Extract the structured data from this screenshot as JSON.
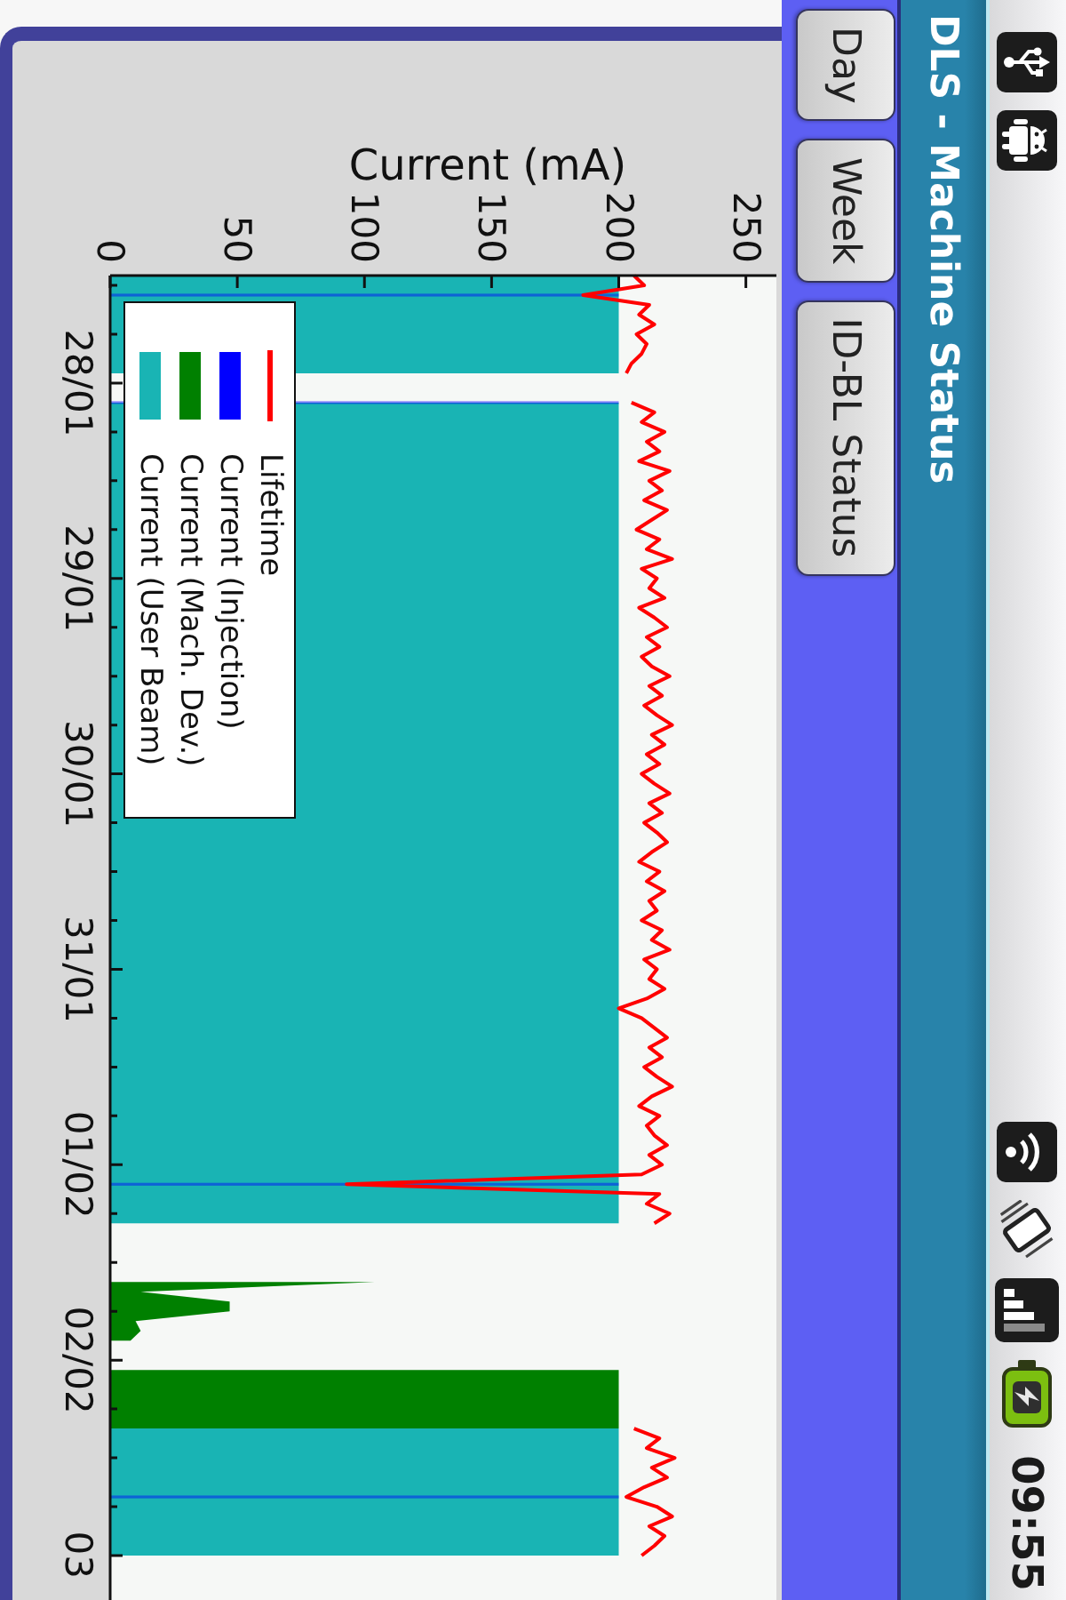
{
  "status_bar": {
    "time": "09:55"
  },
  "title_bar": {
    "title": "DLS - Machine Status"
  },
  "buttons": [
    "Day",
    "Week",
    "ID-BL Status"
  ],
  "chart": {
    "chart_data": {
      "type": "area",
      "orientation": "horizontal",
      "xlabel": "Current (mA)",
      "xlim": [
        0,
        262
      ],
      "xticks": [
        0,
        50,
        100,
        150,
        200,
        250
      ],
      "legend": "upper left",
      "categories": [
        null,
        null,
        null,
        null,
        null,
        null,
        null,
        null,
        null,
        null,
        null,
        "28/01",
        null,
        null,
        null,
        null,
        null,
        null,
        null,
        null,
        null,
        null,
        null,
        null,
        null,
        null,
        null,
        null,
        null,
        null,
        null,
        "29/01",
        null,
        null,
        null,
        null,
        null,
        null,
        null,
        null,
        null,
        null,
        null,
        null,
        null,
        null,
        null,
        null,
        null,
        null,
        null,
        "30/01",
        null,
        null,
        null,
        null,
        null,
        null,
        null,
        null,
        null,
        null,
        null,
        null,
        null,
        null,
        null,
        null,
        null,
        null,
        null,
        "31/01",
        null,
        null,
        null,
        null,
        null,
        null,
        null,
        null,
        null,
        null,
        null,
        null,
        null,
        null,
        null,
        null,
        null,
        null,
        null,
        "01/02",
        null,
        null,
        null,
        null,
        null,
        null,
        null,
        null,
        null,
        null,
        null,
        null,
        null,
        null,
        null,
        null,
        null,
        null,
        null,
        "02/02",
        null,
        null,
        null,
        null,
        null,
        null,
        null,
        null,
        null,
        null,
        null,
        null,
        null,
        null,
        null,
        null,
        null,
        null,
        null,
        "03"
      ],
      "series": [
        {
          "name": "Lifetime",
          "color": "#ff0000",
          "type": "line",
          "values": [
            206,
            210,
            186,
            212,
            208,
            214,
            207,
            211,
            209,
            205,
            203,
            null,
            null,
            205,
            214,
            209,
            218,
            211,
            216,
            208,
            220,
            212,
            217,
            210,
            219,
            213,
            207,
            216,
            211,
            221,
            209,
            215,
            212,
            218,
            208,
            214,
            219,
            211,
            216,
            209,
            213,
            220,
            212,
            217,
            210,
            215,
            221,
            213,
            218,
            211,
            216,
            209,
            214,
            220,
            212,
            217,
            210,
            215,
            219,
            213,
            208,
            216,
            211,
            218,
            212,
            215,
            209,
            217,
            213,
            220,
            210,
            215,
            212,
            218,
            211,
            200,
            209,
            214,
            219,
            212,
            217,
            210,
            215,
            221,
            213,
            208,
            216,
            211,
            214,
            219,
            212,
            217,
            209,
            93,
            216,
            211,
            220,
            214,
            null,
            null,
            null,
            null,
            null,
            null,
            null,
            null,
            null,
            null,
            null,
            null,
            null,
            null,
            null,
            null,
            null,
            null,
            null,
            null,
            206,
            216,
            211,
            222,
            213,
            219,
            210,
            203,
            215,
            221,
            212,
            218,
            214,
            209
          ]
        },
        {
          "name": "Current (Injection)",
          "color": "#0000ff",
          "type": "area",
          "values": [
            null,
            null,
            200,
            null,
            null,
            null,
            null,
            null,
            null,
            null,
            null,
            null,
            null,
            200,
            null,
            null,
            null,
            null,
            null,
            null,
            null,
            null,
            null,
            null,
            null,
            null,
            null,
            null,
            null,
            null,
            null,
            null,
            null,
            null,
            null,
            null,
            null,
            null,
            null,
            null,
            null,
            null,
            null,
            null,
            null,
            null,
            null,
            null,
            null,
            null,
            null,
            null,
            null,
            null,
            null,
            null,
            null,
            null,
            null,
            null,
            null,
            null,
            null,
            null,
            null,
            null,
            null,
            null,
            null,
            null,
            null,
            null,
            null,
            null,
            null,
            null,
            null,
            null,
            null,
            null,
            null,
            null,
            null,
            null,
            null,
            null,
            null,
            null,
            null,
            null,
            null,
            null,
            null,
            200,
            null,
            null,
            null,
            null,
            null,
            null,
            null,
            null,
            null,
            null,
            null,
            null,
            null,
            null,
            null,
            null,
            null,
            null,
            null,
            null,
            null,
            null,
            null,
            null,
            null,
            null,
            null,
            null,
            null,
            null,
            null,
            200,
            null,
            null,
            null,
            null,
            null,
            null
          ]
        },
        {
          "name": "Current (Mach. Dev.)",
          "color": "#008000",
          "type": "area",
          "values": [
            null,
            null,
            null,
            null,
            null,
            null,
            null,
            null,
            null,
            null,
            null,
            null,
            null,
            null,
            null,
            null,
            null,
            null,
            null,
            null,
            null,
            null,
            null,
            null,
            null,
            null,
            null,
            null,
            null,
            null,
            null,
            null,
            null,
            null,
            null,
            null,
            null,
            null,
            null,
            null,
            null,
            null,
            null,
            null,
            null,
            null,
            null,
            null,
            null,
            null,
            null,
            null,
            null,
            null,
            null,
            null,
            null,
            null,
            null,
            null,
            null,
            null,
            null,
            null,
            null,
            null,
            null,
            null,
            null,
            null,
            null,
            null,
            null,
            null,
            null,
            null,
            null,
            null,
            null,
            null,
            null,
            null,
            null,
            null,
            null,
            null,
            null,
            null,
            null,
            null,
            null,
            null,
            null,
            null,
            null,
            null,
            null,
            null,
            null,
            null,
            null,
            null,
            null,
            104,
            12,
            47,
            47,
            10,
            12,
            8,
            null,
            null,
            200,
            200,
            200,
            200,
            200,
            200,
            200,
            null,
            null,
            null,
            null,
            null,
            null,
            null,
            null,
            null,
            null,
            null,
            null,
            null
          ]
        },
        {
          "name": "Current (User Beam)",
          "color": "#19b4b4",
          "type": "area",
          "values": [
            200,
            200,
            200,
            200,
            200,
            200,
            200,
            200,
            200,
            200,
            200,
            null,
            null,
            200,
            200,
            200,
            200,
            200,
            200,
            200,
            200,
            200,
            200,
            200,
            200,
            200,
            200,
            200,
            200,
            200,
            200,
            200,
            200,
            200,
            200,
            200,
            200,
            200,
            200,
            200,
            200,
            200,
            200,
            200,
            200,
            200,
            200,
            200,
            200,
            200,
            200,
            200,
            200,
            200,
            200,
            200,
            200,
            200,
            200,
            200,
            200,
            200,
            200,
            200,
            200,
            200,
            200,
            200,
            200,
            200,
            200,
            200,
            200,
            200,
            200,
            200,
            200,
            200,
            200,
            200,
            200,
            200,
            200,
            200,
            200,
            200,
            200,
            200,
            200,
            200,
            200,
            200,
            200,
            200,
            200,
            200,
            200,
            200,
            null,
            null,
            null,
            null,
            null,
            null,
            null,
            null,
            null,
            null,
            null,
            null,
            null,
            null,
            null,
            null,
            null,
            null,
            null,
            null,
            200,
            200,
            200,
            200,
            200,
            200,
            200,
            200,
            200,
            200,
            200,
            200,
            200,
            200
          ]
        }
      ]
    }
  }
}
